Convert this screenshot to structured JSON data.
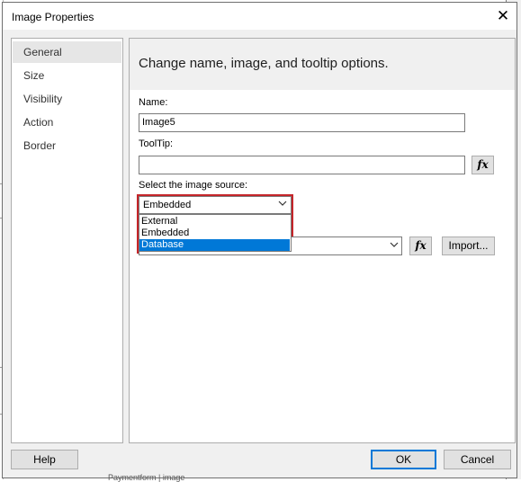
{
  "dialog": {
    "title": "Image Properties",
    "close_glyph": "✕"
  },
  "nav": {
    "items": [
      {
        "label": "General"
      },
      {
        "label": "Size"
      },
      {
        "label": "Visibility"
      },
      {
        "label": "Action"
      },
      {
        "label": "Border"
      }
    ],
    "selected": "General"
  },
  "main": {
    "heading": "Change name, image, and tooltip options.",
    "name_label": "Name:",
    "name_value": "Image5",
    "tooltip_label": "ToolTip:",
    "tooltip_value": "",
    "fx_label": "fx",
    "source_label": "Select the image source:",
    "source_value": "Embedded",
    "source_options": [
      {
        "label": "External"
      },
      {
        "label": "Embedded"
      },
      {
        "label": "Database"
      }
    ],
    "source_highlighted_option": "Database",
    "import_label": "Import..."
  },
  "footer": {
    "help_label": "Help",
    "ok_label": "OK",
    "cancel_label": "Cancel"
  },
  "background": {
    "bottom_text": "Paymentform | image"
  },
  "colors": {
    "selection_blue": "#0078d7",
    "highlight_red": "#c5252a",
    "dialog_bg": "#f0f0f0"
  },
  "icons": {
    "close": "close-icon",
    "dropdown": "chevron-down-icon"
  }
}
